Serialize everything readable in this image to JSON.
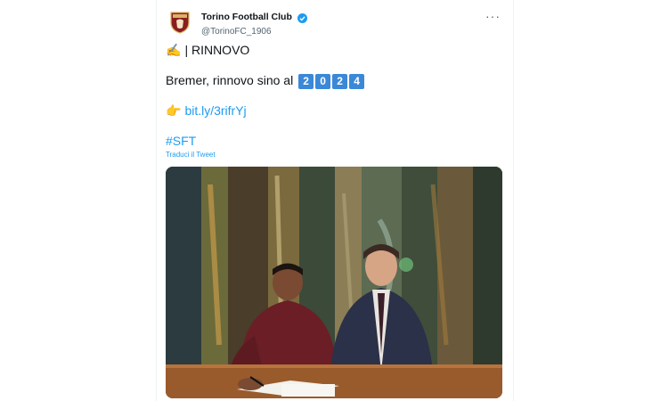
{
  "tweet": {
    "author_name": "Torino Football Club",
    "author_handle": "@TorinoFC_1906",
    "more_label": "···",
    "line1_emoji": "✍️",
    "line1_text": "| RINNOVO",
    "line2_text": "Bremer, rinnovo sino al",
    "year_digits": [
      "2",
      "0",
      "2",
      "4"
    ],
    "link_emoji": "👉",
    "link_text": "bit.ly/3rifrYj",
    "hashtag": "#SFT",
    "translate_label": "Traduci il Tweet"
  },
  "colors": {
    "link": "#1d9bf0",
    "year_box": "#3b88d8",
    "verified": "#1d9bf0",
    "torino_crest": "#8a1e1e"
  },
  "icons": {
    "avatar": "torino-crest-icon",
    "verified": "verified-badge-icon",
    "more": "more-options-icon"
  }
}
